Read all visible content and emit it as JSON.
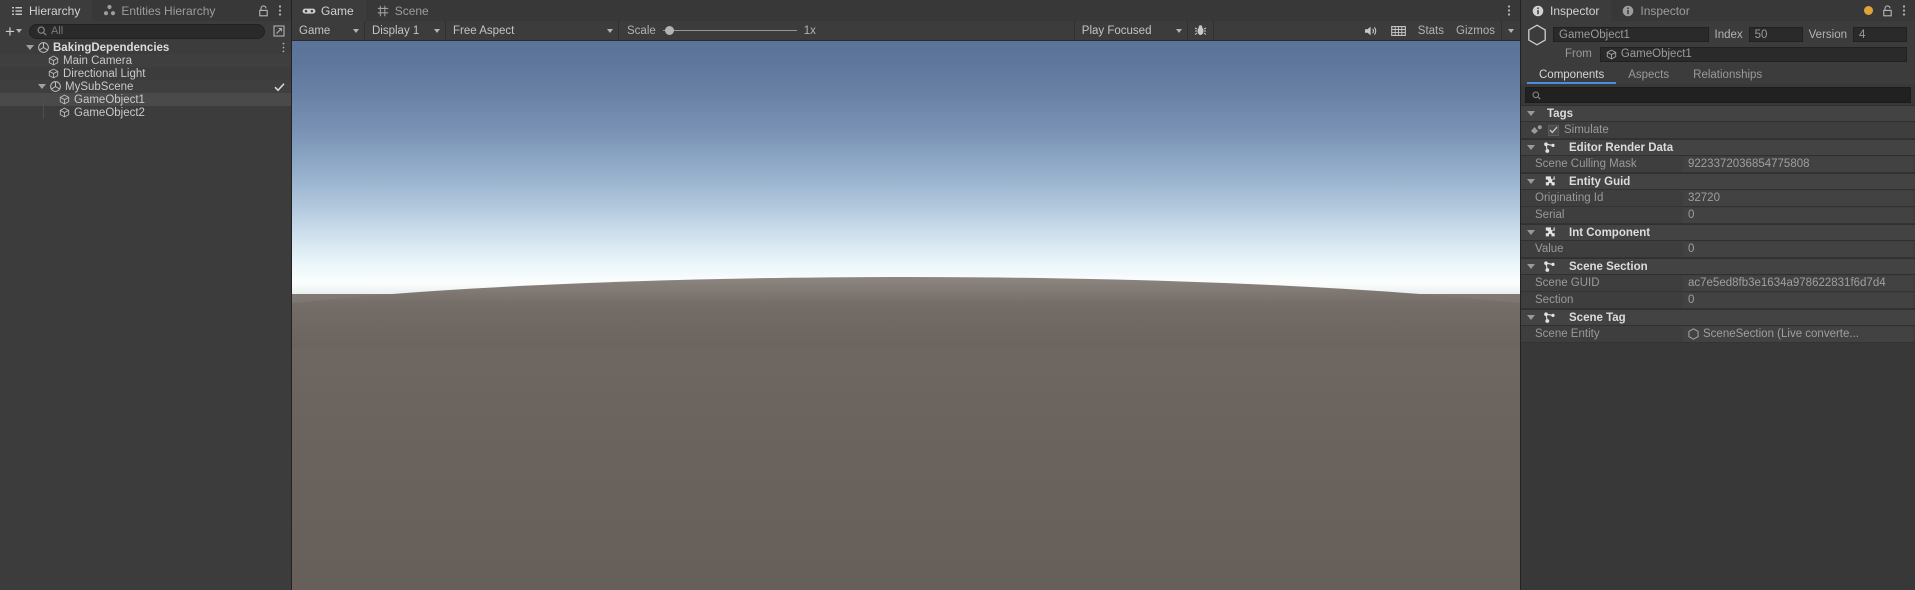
{
  "hierarchy": {
    "tabs": [
      {
        "label": "Hierarchy",
        "icon": "hierarchy-list-icon",
        "active": true
      },
      {
        "label": "Entities Hierarchy",
        "icon": "entities-icon",
        "active": false
      }
    ],
    "toolbar": {
      "add_label": "+",
      "search_placeholder": "All",
      "search_value": "",
      "search_icon": "search-icon",
      "lock_icon": "lock-icon",
      "menu_icon": "kebab-menu-icon",
      "sort_icon": "visibility-toggle-icon"
    },
    "rows": [
      {
        "label": "BakingDependencies",
        "icon": "unity-scene-icon",
        "depth": 0,
        "expanded": true,
        "selected": false,
        "menu": true,
        "check": false
      },
      {
        "label": "Main Camera",
        "icon": "gameobject-cube-icon",
        "depth": 1,
        "expanded": null,
        "selected": false,
        "menu": false,
        "check": false
      },
      {
        "label": "Directional Light",
        "icon": "gameobject-cube-icon",
        "depth": 1,
        "expanded": null,
        "selected": false,
        "menu": false,
        "check": false
      },
      {
        "label": "MySubScene",
        "icon": "unity-scene-icon",
        "depth": 1,
        "expanded": true,
        "selected": false,
        "menu": false,
        "check": true
      },
      {
        "label": "GameObject1",
        "icon": "gameobject-cube-icon",
        "depth": 2,
        "expanded": null,
        "selected": true,
        "menu": false,
        "check": false
      },
      {
        "label": "GameObject2",
        "icon": "gameobject-cube-icon",
        "depth": 2,
        "expanded": null,
        "selected": false,
        "menu": false,
        "check": false
      }
    ]
  },
  "game": {
    "tabs": [
      {
        "label": "Game",
        "icon": "gamepad-icon",
        "active": true
      },
      {
        "label": "Scene",
        "icon": "grid-scene-icon",
        "active": false
      }
    ],
    "toolbar": {
      "view_mode": "Game",
      "display": "Display 1",
      "aspect": "Free Aspect",
      "scale_label": "Scale",
      "scale_value": "1x",
      "scale_fraction": 0,
      "play_mode": "Play Focused",
      "bug_icon": "bug-report-icon",
      "mute_icon": "mute-audio-icon",
      "stats_grid_icon": "stats-grid-icon",
      "stats_label": "Stats",
      "gizmos_label": "Gizmos"
    }
  },
  "inspector": {
    "tabs": [
      {
        "label": "Inspector",
        "icon": "info-circle-icon",
        "active": true
      },
      {
        "label": "Inspector",
        "icon": "info-circle-icon",
        "active": false
      }
    ],
    "right_icons": {
      "indicator": "orange-dot-icon",
      "lock": "lock-icon",
      "menu": "kebab-menu-icon"
    },
    "entity": {
      "entity_icon": "entity-hexagon-icon",
      "name": "GameObject1",
      "index_label": "Index",
      "index_value": "50",
      "version_label": "Version",
      "version_value": "4",
      "from_label": "From",
      "from_value": "GameObject1",
      "from_icon": "gameobject-cube-icon"
    },
    "subtabs": [
      {
        "label": "Components",
        "active": true
      },
      {
        "label": "Aspects",
        "active": false
      },
      {
        "label": "Relationships",
        "active": false
      }
    ],
    "component_search": {
      "placeholder": "",
      "value": "",
      "icon": "search-icon"
    },
    "components": [
      {
        "title": "Tags",
        "icon": null,
        "expanded": true,
        "kind": "tags",
        "tags": [
          {
            "label": "Simulate",
            "checked": true,
            "icon": "simulate-tag-icon"
          }
        ],
        "props": []
      },
      {
        "title": "Editor Render Data",
        "icon": "shared-component-icon",
        "expanded": true,
        "kind": "component",
        "props": [
          {
            "name": "Scene Culling Mask",
            "value": "9223372036854775808",
            "icon": null
          }
        ]
      },
      {
        "title": "Entity Guid",
        "icon": "component-puzzle-icon",
        "expanded": true,
        "kind": "component",
        "props": [
          {
            "name": "Originating Id",
            "value": "32720",
            "icon": null
          },
          {
            "name": "Serial",
            "value": "0",
            "icon": null
          }
        ]
      },
      {
        "title": "Int Component",
        "icon": "component-puzzle-icon",
        "expanded": true,
        "kind": "component",
        "props": [
          {
            "name": "Value",
            "value": "0",
            "icon": null
          }
        ]
      },
      {
        "title": "Scene Section",
        "icon": "shared-component-icon",
        "expanded": true,
        "kind": "component",
        "props": [
          {
            "name": "Scene GUID",
            "value": "ac7e5ed8fb3e1634a978622831f6d7d4",
            "icon": null
          },
          {
            "name": "Section",
            "value": "0",
            "icon": null
          }
        ]
      },
      {
        "title": "Scene Tag",
        "icon": "shared-component-icon",
        "expanded": true,
        "kind": "component",
        "props": [
          {
            "name": "Scene Entity",
            "value": "SceneSection (Live converte...",
            "icon": "entity-hexagon-icon"
          }
        ]
      }
    ]
  },
  "colors": {
    "panel_bg": "#3c3c3c",
    "window_bg": "#383838",
    "accent_blue": "#4a8ddc",
    "sky_top": "#5b7398",
    "sky_horizon": "#fbfdfd",
    "ground": "#6b635e",
    "orange_indicator": "#e0a33a"
  }
}
